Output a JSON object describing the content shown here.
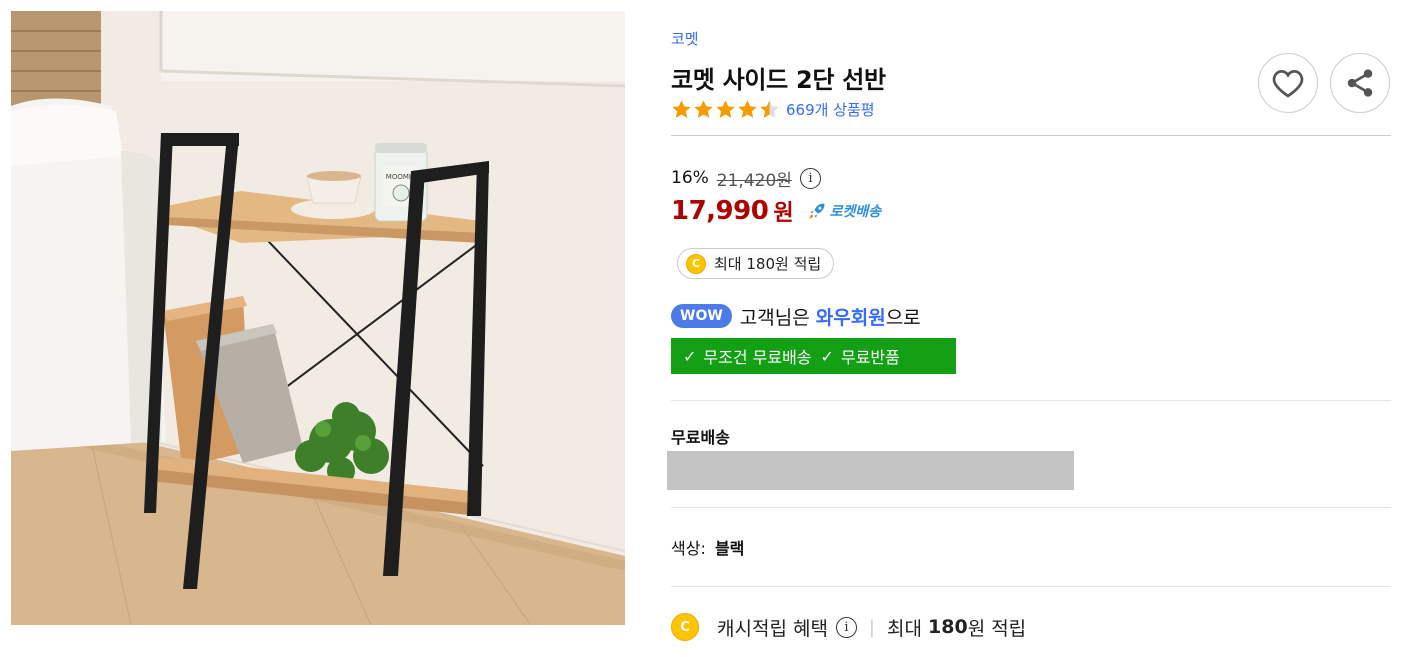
{
  "product": {
    "brand": "코멧",
    "title": "코멧 사이드 2단 선반",
    "rating": 4.5,
    "review_text": "669개 상품평",
    "image_alt": "코멧 사이드 2단 선반"
  },
  "actions": {
    "wish_icon": "heart-icon",
    "share_icon": "share-icon"
  },
  "price": {
    "discount": "16%",
    "original": "21,420원",
    "sale_amount": "17,990",
    "sale_unit": "원",
    "rocket_label": "로켓배송"
  },
  "cash": {
    "pill_coin": "C",
    "pill_text": "최대 180원 적립"
  },
  "wow": {
    "badge": "WOW",
    "prefix": "고객님은",
    "link": "와우회원",
    "suffix": "으로",
    "benefit_1": "무조건 무료배송",
    "benefit_2": "무료반품"
  },
  "shipping": {
    "label": "무료배송"
  },
  "option": {
    "label": "색상:",
    "value": "블랙"
  },
  "cashback": {
    "coin": "C",
    "label": "캐시적립 혜택",
    "max_prefix": "최대",
    "amount": "180",
    "suffix": "원 적립"
  },
  "colors": {
    "brand_link": "#346aff",
    "sale_red": "#ae0000",
    "wow_green": "#14a014",
    "rocket_blue": "#2e8ee5",
    "coin_yellow": "#ffc400"
  }
}
